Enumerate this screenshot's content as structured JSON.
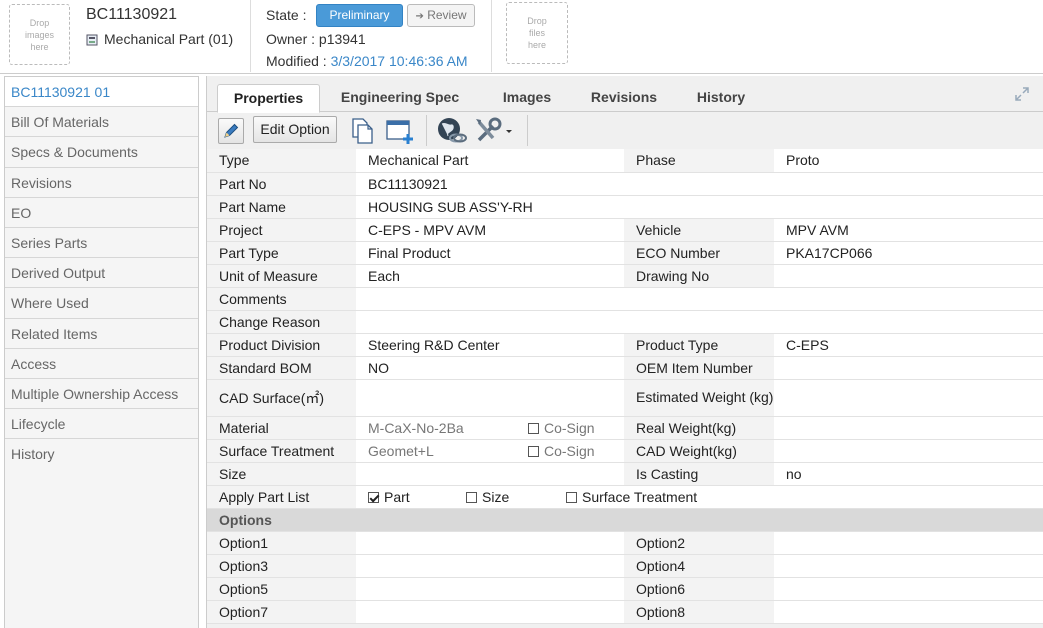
{
  "header": {
    "drop_images": "Drop\nimages\nhere",
    "drop_files": "Drop\nfiles\nhere",
    "part_id": "BC11130921",
    "part_type_label": "Mechanical Part (01)",
    "state_label": "State :",
    "state_current": "Preliminary",
    "state_next": "Review",
    "owner_label": "Owner : p13941",
    "modified_label": "Modified :",
    "modified_value": "3/3/2017 10:46:36 AM",
    "accent_color": "#4a9ad8"
  },
  "sidebar": {
    "items": [
      {
        "label": "BC11130921 01",
        "active": true
      },
      {
        "label": "Bill Of Materials"
      },
      {
        "label": "Specs & Documents"
      },
      {
        "label": "Revisions"
      },
      {
        "label": "EO"
      },
      {
        "label": "Series Parts"
      },
      {
        "label": "Derived Output"
      },
      {
        "label": "Where Used"
      },
      {
        "label": "Related Items"
      },
      {
        "label": "Access"
      },
      {
        "label": "Multiple Ownership Access"
      },
      {
        "label": "Lifecycle"
      },
      {
        "label": "History"
      }
    ]
  },
  "tabs": [
    "Properties",
    "Engineering Spec",
    "Images",
    "Revisions",
    "History"
  ],
  "toolbar": {
    "edit_option_label": "Edit Option",
    "icons": [
      "pencil-icon",
      "copy-icon",
      "new-window-icon",
      "globe-link-icon",
      "tools-icon"
    ]
  },
  "properties": {
    "type": {
      "label": "Type",
      "value": "Mechanical Part"
    },
    "phase": {
      "label": "Phase",
      "value": "Proto"
    },
    "part_no": {
      "label": "Part No",
      "value": "BC11130921"
    },
    "part_name": {
      "label": "Part Name",
      "value": "HOUSING SUB ASS'Y-RH"
    },
    "project": {
      "label": "Project",
      "value": "C-EPS - MPV AVM"
    },
    "vehicle": {
      "label": "Vehicle",
      "value": "MPV AVM"
    },
    "part_type": {
      "label": "Part Type",
      "value": "Final Product"
    },
    "eco_number": {
      "label": "ECO Number",
      "value": "PKA17CP066"
    },
    "uom": {
      "label": "Unit of Measure",
      "value": "Each"
    },
    "drawing_no": {
      "label": "Drawing No",
      "value": ""
    },
    "comments": {
      "label": "Comments",
      "value": ""
    },
    "change_reason": {
      "label": "Change Reason",
      "value": ""
    },
    "product_division": {
      "label": "Product Division",
      "value": "Steering R&D Center"
    },
    "product_type": {
      "label": "Product Type",
      "value": "C-EPS"
    },
    "standard_bom": {
      "label": "Standard BOM",
      "value": "NO"
    },
    "oem_item_number": {
      "label": "OEM Item Number",
      "value": ""
    },
    "cad_surface": {
      "label": "CAD Surface(㎡)",
      "value": ""
    },
    "estimated_weight": {
      "label": "Estimated Weight (kg)",
      "value": ""
    },
    "material": {
      "label": "Material",
      "value": "M-CaX-No-2Ba",
      "cosign": "Co-Sign",
      "cosign_checked": false
    },
    "real_weight": {
      "label": "Real Weight(kg)",
      "value": ""
    },
    "surface_treatment": {
      "label": "Surface Treatment",
      "value": "Geomet+L",
      "cosign": "Co-Sign",
      "cosign_checked": false
    },
    "cad_weight": {
      "label": "CAD Weight(kg)",
      "value": ""
    },
    "size": {
      "label": "Size",
      "value": ""
    },
    "is_casting": {
      "label": "Is Casting",
      "value": "no"
    },
    "apply_part_list": {
      "label": "Apply Part List",
      "options": [
        {
          "label": "Part",
          "checked": true
        },
        {
          "label": "Size",
          "checked": false
        },
        {
          "label": "Surface Treatment",
          "checked": false
        }
      ]
    }
  },
  "options": {
    "section_label": "Options",
    "rows": [
      [
        "Option1",
        "Option2"
      ],
      [
        "Option3",
        "Option4"
      ],
      [
        "Option5",
        "Option6"
      ],
      [
        "Option7",
        "Option8"
      ]
    ]
  }
}
